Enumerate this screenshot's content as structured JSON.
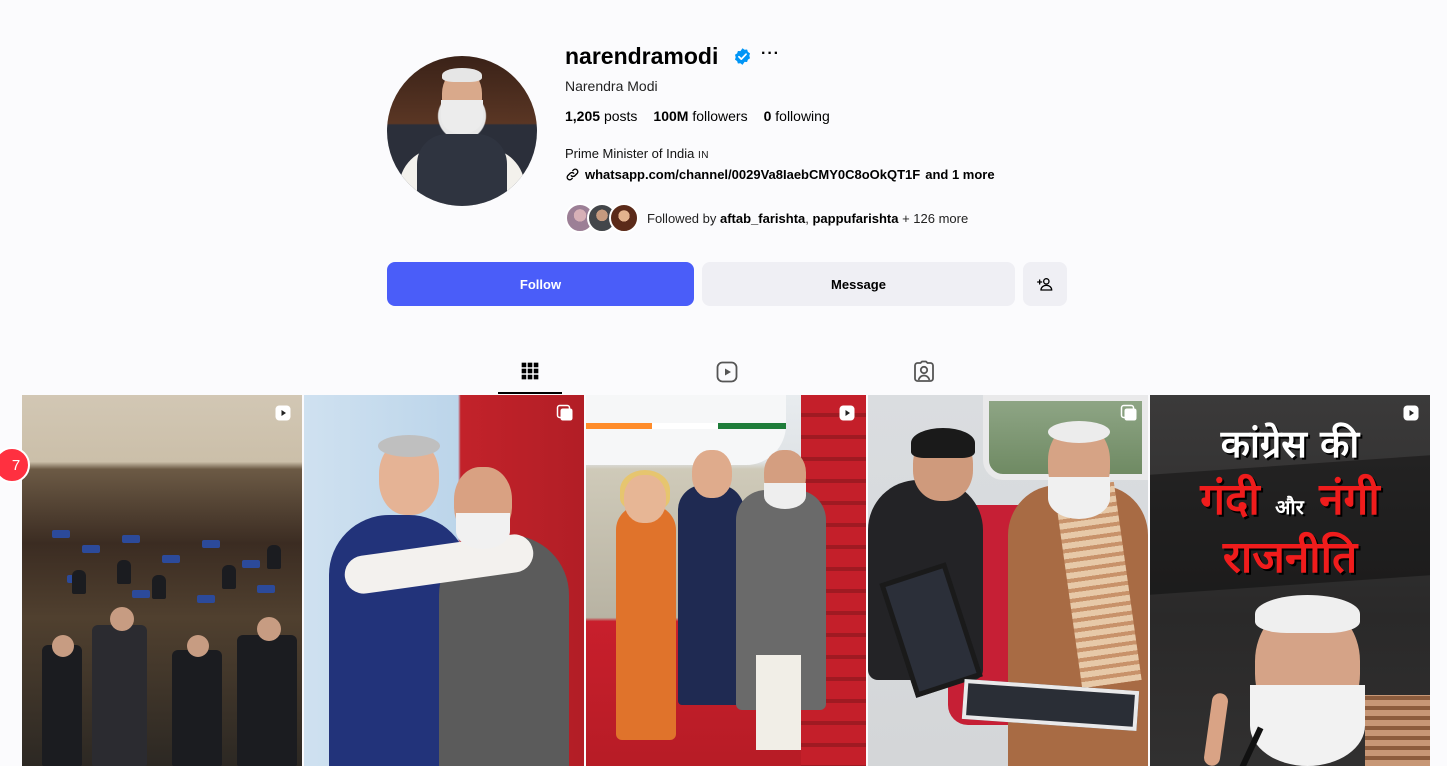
{
  "profile": {
    "username": "narendramodi",
    "full_name": "Narendra Modi",
    "stats": {
      "posts_count": "1,205",
      "posts_label": "posts",
      "followers_count": "100M",
      "followers_label": "followers",
      "following_count": "0",
      "following_label": "following"
    },
    "bio": "Prime Minister of India",
    "bio_flag": "IN",
    "link": "whatsapp.com/channel/0029Va8IaebCMY0C8oOkQT1F",
    "link_more": "and 1 more",
    "followed_by": {
      "prefix": "Followed by",
      "user1": "aftab_farishta",
      "user2": "pappufarishta",
      "suffix": "+ 126 more"
    }
  },
  "actions": {
    "follow_label": "Follow",
    "message_label": "Message"
  },
  "icons": {
    "verified": "verified-badge-icon",
    "more": "more-options-icon",
    "link": "link-icon",
    "suggest": "add-person-icon",
    "posts_tab": "grid-icon",
    "reels_tab": "reels-icon",
    "tagged_tab": "tagged-icon"
  },
  "posts": [
    {
      "type": "reel"
    },
    {
      "type": "carousel"
    },
    {
      "type": "reel"
    },
    {
      "type": "carousel"
    },
    {
      "type": "reel",
      "overlay_line1": "कांग्रेस की",
      "overlay_line2": "गंदी",
      "overlay_joiner": "और",
      "overlay_line2b": "नंगी",
      "overlay_line3": "राजनीति"
    }
  ],
  "notification_count": "7",
  "colors": {
    "follow_button": "#4a5df9",
    "verified": "#0095f6",
    "notification": "#ff3040"
  }
}
